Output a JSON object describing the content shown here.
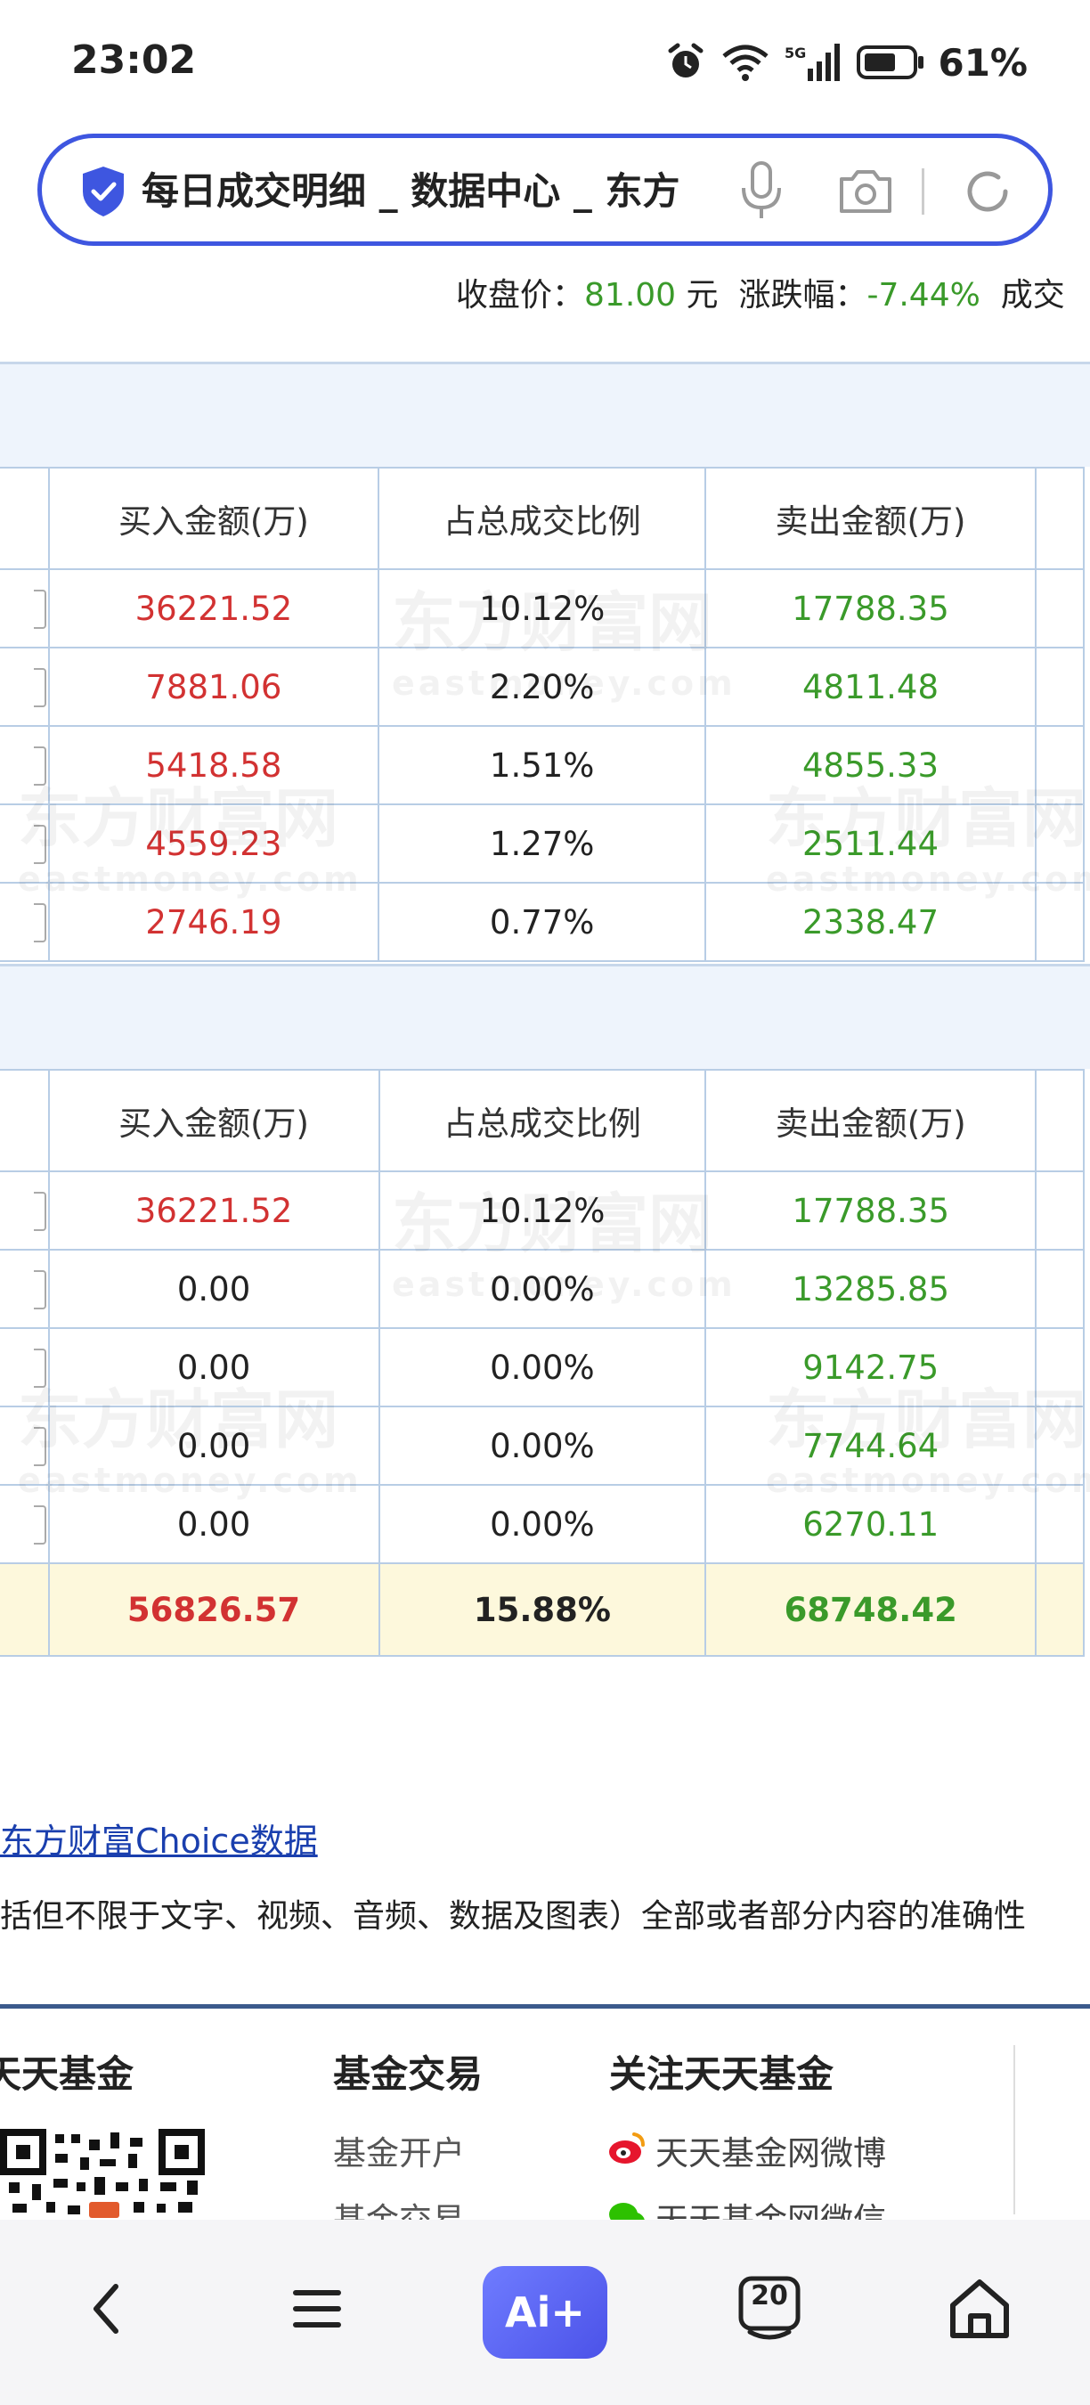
{
  "status_bar": {
    "time": "23:02",
    "battery": "61%"
  },
  "address_bar": {
    "url_text": "每日成交明细 _ 数据中心 _ 东方"
  },
  "price_info": {
    "close_label": "收盘价：",
    "close_value": "81.00",
    "close_unit": "元",
    "change_label": "涨跌幅：",
    "change_value": "-7.44%",
    "trade_label": "成交"
  },
  "table1": {
    "headers": [
      "买入金额(万)",
      "占总成交比例",
      "卖出金额(万)"
    ],
    "rows": [
      [
        "36221.52",
        "10.12%",
        "17788.35"
      ],
      [
        "7881.06",
        "2.20%",
        "4811.48"
      ],
      [
        "5418.58",
        "1.51%",
        "4855.33"
      ],
      [
        "4559.23",
        "1.27%",
        "2511.44"
      ],
      [
        "2746.19",
        "0.77%",
        "2338.47"
      ]
    ]
  },
  "table2": {
    "headers": [
      "买入金额(万)",
      "占总成交比例",
      "卖出金额(万)"
    ],
    "rows": [
      [
        "36221.52",
        "10.12%",
        "17788.35"
      ],
      [
        "0.00",
        "0.00%",
        "13285.85"
      ],
      [
        "0.00",
        "0.00%",
        "9142.75"
      ],
      [
        "0.00",
        "0.00%",
        "7744.64"
      ],
      [
        "0.00",
        "0.00%",
        "6270.11"
      ]
    ],
    "total": [
      "56826.57",
      "15.88%",
      "68748.42"
    ]
  },
  "watermark": {
    "cn": "东方财富网",
    "en": "eastmoney.com"
  },
  "source_link": "东方财富Choice数据",
  "disclaimer": "括但不限于文字、视频、音频、数据及图表）全部或者部分内容的准确性",
  "footer": {
    "col1_title": "天天基金",
    "col2_title": "基金交易",
    "col2_links": [
      "基金开户",
      "基金交易"
    ],
    "col3_title": "关注天天基金",
    "col3_links": [
      "天天基金网微博",
      "天天基金网微信"
    ]
  },
  "bottom_nav": {
    "ai_label": "Ai+",
    "tabs_count": "20"
  }
}
